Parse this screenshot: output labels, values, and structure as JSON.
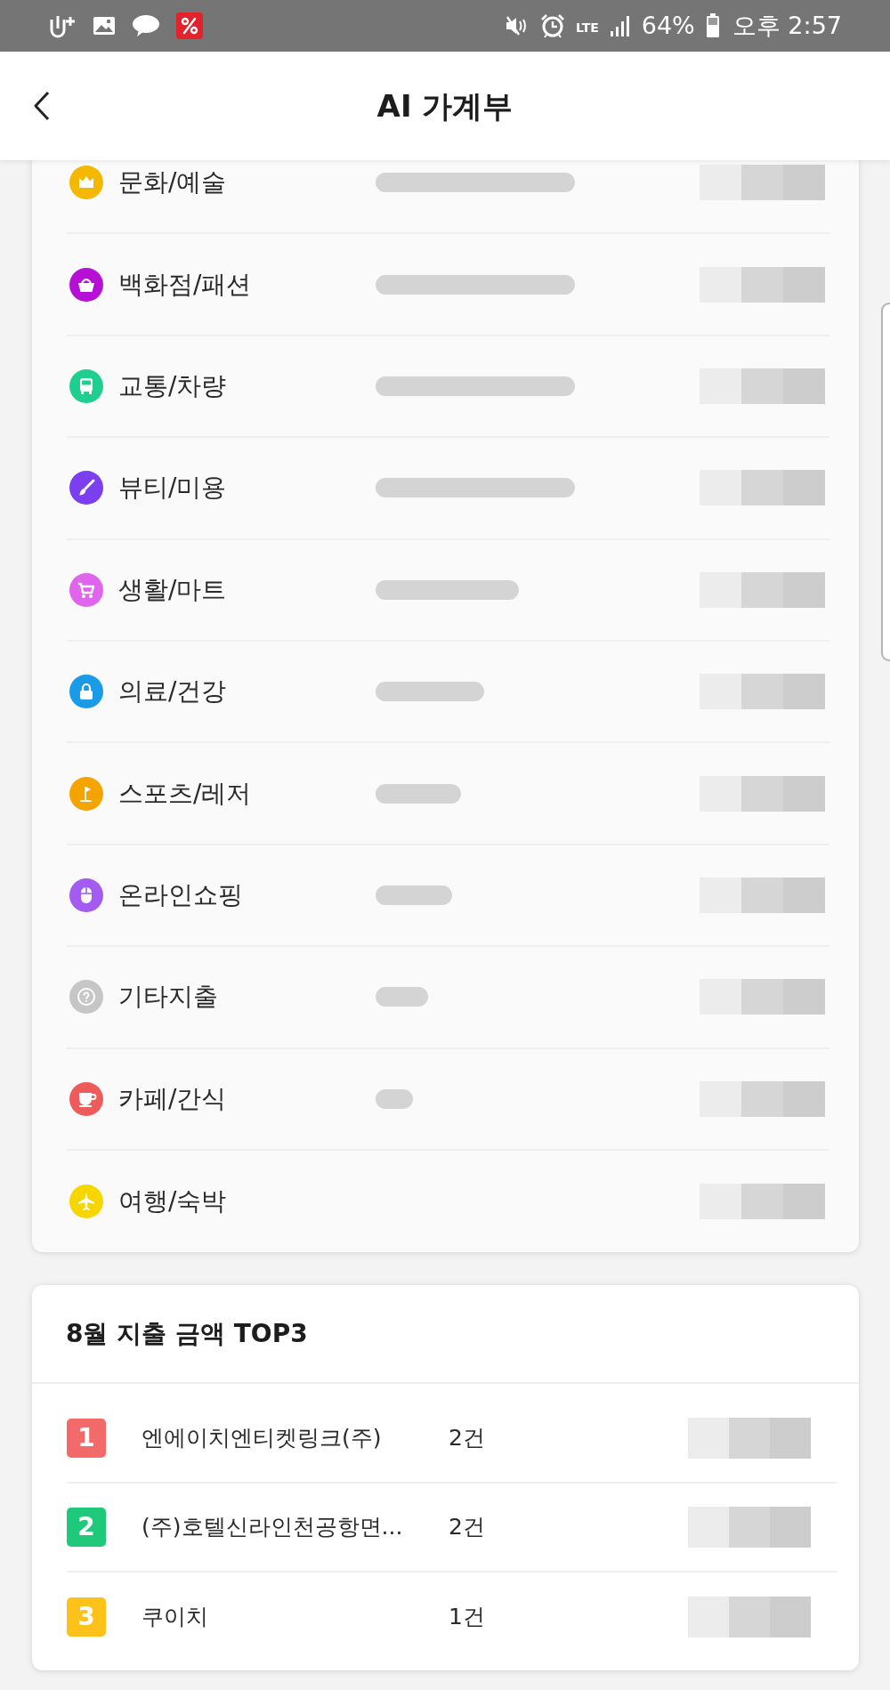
{
  "status_bar": {
    "network": "LTE",
    "battery": "64%",
    "time": "오후 2:57"
  },
  "header": {
    "title": "AI 가계부"
  },
  "categories": [
    {
      "label": "문화/예술",
      "color": "#f5b800"
    },
    {
      "label": "백화점/패션",
      "color": "#b60fd6"
    },
    {
      "label": "교통/차량",
      "color": "#1fcf8f"
    },
    {
      "label": "뷰티/미용",
      "color": "#7b3ff0"
    },
    {
      "label": "생활/마트",
      "color": "#e065ec"
    },
    {
      "label": "의료/건강",
      "color": "#1a9be8"
    },
    {
      "label": "스포츠/레저",
      "color": "#f5a300"
    },
    {
      "label": "온라인쇼핑",
      "color": "#a35bf2"
    },
    {
      "label": "기타지출",
      "color": "#c6c6c6"
    },
    {
      "label": "카페/간식",
      "color": "#ee5b5b"
    },
    {
      "label": "여행/숙박",
      "color": "#f7d600"
    }
  ],
  "top3": {
    "title": "8월 지출 금액 TOP3",
    "rows": [
      {
        "rank": "1",
        "color": "#f26a6a",
        "name": "엔에이치엔티켓링크(주)",
        "count": "2건"
      },
      {
        "rank": "2",
        "color": "#1fc97a",
        "name": "(주)호텔신라인천공항면...",
        "count": "2건"
      },
      {
        "rank": "3",
        "color": "#fdc21a",
        "name": "쿠이치",
        "count": "1건"
      }
    ]
  }
}
